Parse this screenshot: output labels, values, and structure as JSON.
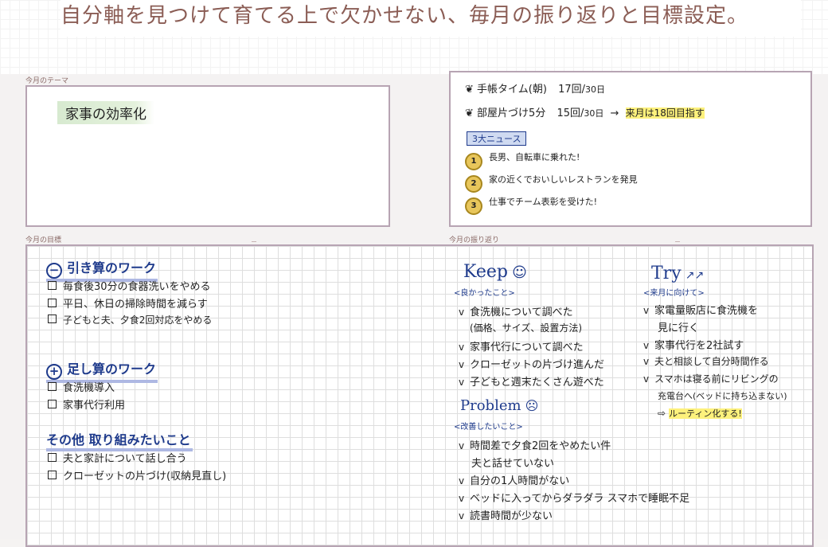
{
  "header": {
    "caption": "自分軸を見つけて育てる上で欠かせない、毎月の振り返りと目標設定。"
  },
  "labels": {
    "theme": "今月のテーマ",
    "goals": "今月の目標",
    "review": "今月の振り返り"
  },
  "theme": {
    "text": "家事の効率化"
  },
  "habits": [
    {
      "name": "手帳タイム(朝)",
      "count": "17回",
      "total": "30日"
    },
    {
      "name": "部屋片づけ5分",
      "count": "15回",
      "total": "30日",
      "arrow": "→",
      "note": "来月は18回目指す"
    }
  ],
  "news": {
    "title": "3大ニュース",
    "items": [
      {
        "num": "1",
        "text": "長男、自転車に乗れた!"
      },
      {
        "num": "2",
        "text": "家の近くでおいしいレストランを発見"
      },
      {
        "num": "3",
        "text": "仕事でチーム表彰を受けた!"
      }
    ]
  },
  "goals": {
    "minus": {
      "symbol": "−",
      "title": "引き算のワーク",
      "items": [
        "毎食後30分の食器洗いをやめる",
        "平日、休日の掃除時間を減らす",
        "子どもと夫、夕食2回対応をやめる"
      ]
    },
    "plus": {
      "symbol": "+",
      "title": "足し算のワーク",
      "items": [
        "食洗機導入",
        "家事代行利用"
      ]
    },
    "other": {
      "title": "その他 取り組みたいこと",
      "items": [
        "夫と家計について話し合う",
        "クローゼットの片づけ(収納見直し)"
      ]
    }
  },
  "review": {
    "keep": {
      "title": "Keep",
      "face": "☺",
      "subtitle": "<良かったこと>",
      "check": "v",
      "items": [
        "食洗機について調べた",
        "(価格、サイズ、設置方法)",
        "家事代行について調べた",
        "クローゼットの片づけ進んだ",
        "子どもと週末たくさん遊べた"
      ]
    },
    "problem": {
      "title": "Problem",
      "face": "☹",
      "subtitle": "<改善したいこと>",
      "check": "v",
      "items": [
        "時間差で夕食2回をやめたい件",
        "夫と話せていない",
        "自分の1人時間がない",
        "ベッドに入ってからダラダラ スマホで睡眠不足",
        "読書時間が少ない"
      ]
    },
    "try": {
      "title": "Try",
      "arrows": "↗↗",
      "subtitle": "<来月に向けて>",
      "check": "v",
      "items": [
        "家電量販店に食洗機を",
        "見に行く",
        "家事代行を2社試す",
        "夫と相談して自分時間作る",
        "スマホは寝る前にリビングの",
        "充電台へ(ベッドに持ち込まない)"
      ],
      "arrow": "⇨",
      "highlight": "ルーティン化する!"
    }
  }
}
